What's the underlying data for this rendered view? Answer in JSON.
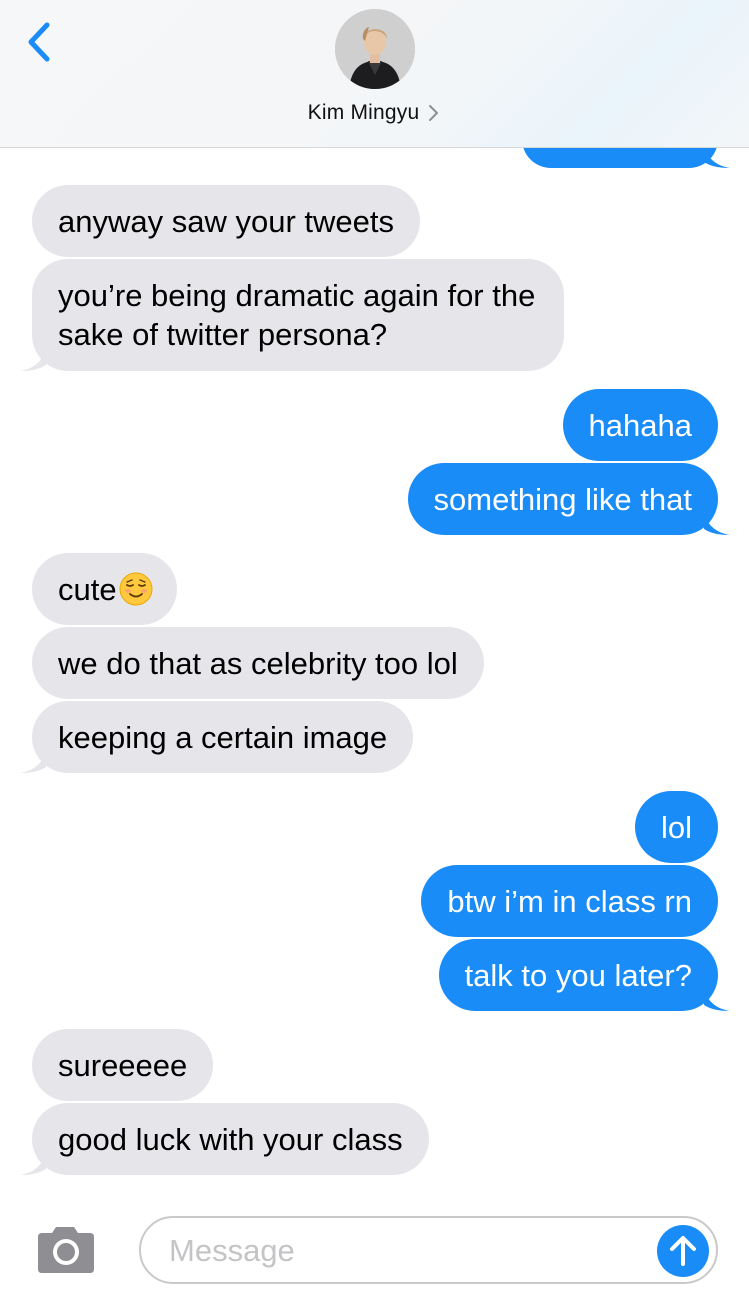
{
  "header": {
    "contact_name": "Kim Mingyu",
    "accent_color": "#1a8cf8"
  },
  "messages": [
    {
      "from": "me",
      "text": ""
    },
    {
      "from": "them",
      "text": "anyway saw your tweets"
    },
    {
      "from": "them",
      "text": "you’re being dramatic again for the sake of twitter persona?"
    },
    {
      "from": "me",
      "text": "hahaha"
    },
    {
      "from": "me",
      "text": "something like that"
    },
    {
      "from": "them",
      "text": "cute",
      "emoji": "relieved-smile-emoji"
    },
    {
      "from": "them",
      "text": "we do that as celebrity too lol"
    },
    {
      "from": "them",
      "text": "keeping a certain image"
    },
    {
      "from": "me",
      "text": "lol"
    },
    {
      "from": "me",
      "text": "btw i’m in class rn"
    },
    {
      "from": "me",
      "text": "talk to you later?"
    },
    {
      "from": "them",
      "text": "sureeeee"
    },
    {
      "from": "them",
      "text": "good luck with your class"
    }
  ],
  "composer": {
    "placeholder": "Message",
    "value": "",
    "camera_icon": "camera-icon",
    "send_icon": "arrow-up-icon"
  },
  "colors": {
    "received_bubble": "#e5e5ea",
    "sent_bubble": "#1a8cf8"
  }
}
